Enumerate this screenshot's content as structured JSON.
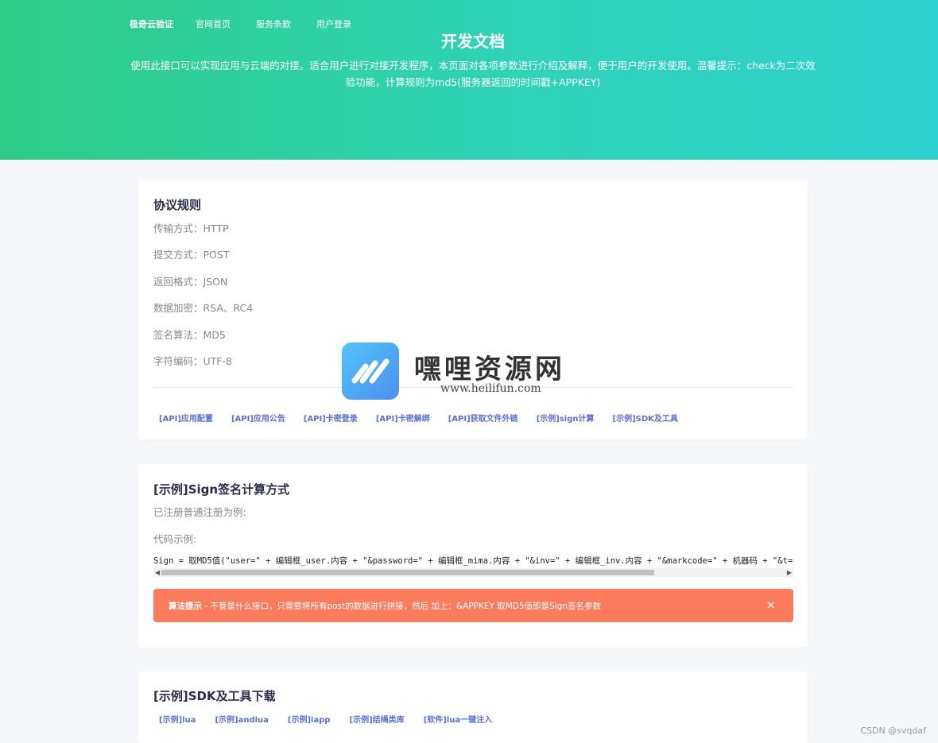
{
  "nav": {
    "brand": "极奇云验证",
    "items": [
      "官网首页",
      "服务条款",
      "用户登录"
    ]
  },
  "hero": {
    "title": "开发文档",
    "desc_line1": "使用此接口可以实现应用与云端的对接。适合用户进行对接开发程序，本页面对各项参数进行介绍及解释，便于用户的开发使用。温馨提示：check为二次效",
    "desc_line2": "验功能，计算规则为md5(服务器返回的时间戳+APPKEY)"
  },
  "protocol": {
    "title": "协议规则",
    "rules": [
      "传输方式：HTTP",
      "提交方式：POST",
      "返回格式：JSON",
      "数据加密：RSA、RC4",
      "签名算法：MD5",
      "字符编码：UTF-8"
    ],
    "links": [
      "[API]应用配置",
      "[API]应用公告",
      "[API]卡密登录",
      "[API]卡密解绑",
      "[API]获取文件外链",
      "[示例]sign计算",
      "[示例]SDK及工具"
    ]
  },
  "sign": {
    "title": "[示例]Sign签名计算方式",
    "line1": "已注册普通注册为例:",
    "line2": "代码示例:",
    "code": "Sign = 取MD5值(\"user=\" + 编辑框_user.内容 + \"&password=\" + 编辑框_mima.内容 + \"&inv=\" + 编辑框_inv.内容 + \"&markcode=\" + 机器码 + \"&t=",
    "alert_bold": "算法提示",
    "alert_text": " - 不管是什么接口，只需要将所有post的数据进行拼接，然后 加上：&APPKEY 取MD5值即是Sign签名参数",
    "alert_close": "×"
  },
  "sdk": {
    "title": "[示例]SDK及工具下载",
    "links": [
      "[示例]lua",
      "[示例]andlua",
      "[示例]iapp",
      "[示例]结绳类库",
      "[软件]lua一键注入"
    ]
  },
  "watermark": {
    "name": "嘿哩资源网",
    "url": "www.heilifun.com"
  },
  "footer": {
    "csdn": "CSDN @svqdaf"
  },
  "colors": {
    "accent_green": "#2ecc87",
    "accent_teal": "#2fd0d0",
    "link_blue": "#5b6fd6",
    "alert_orange": "#fa7c5c"
  }
}
